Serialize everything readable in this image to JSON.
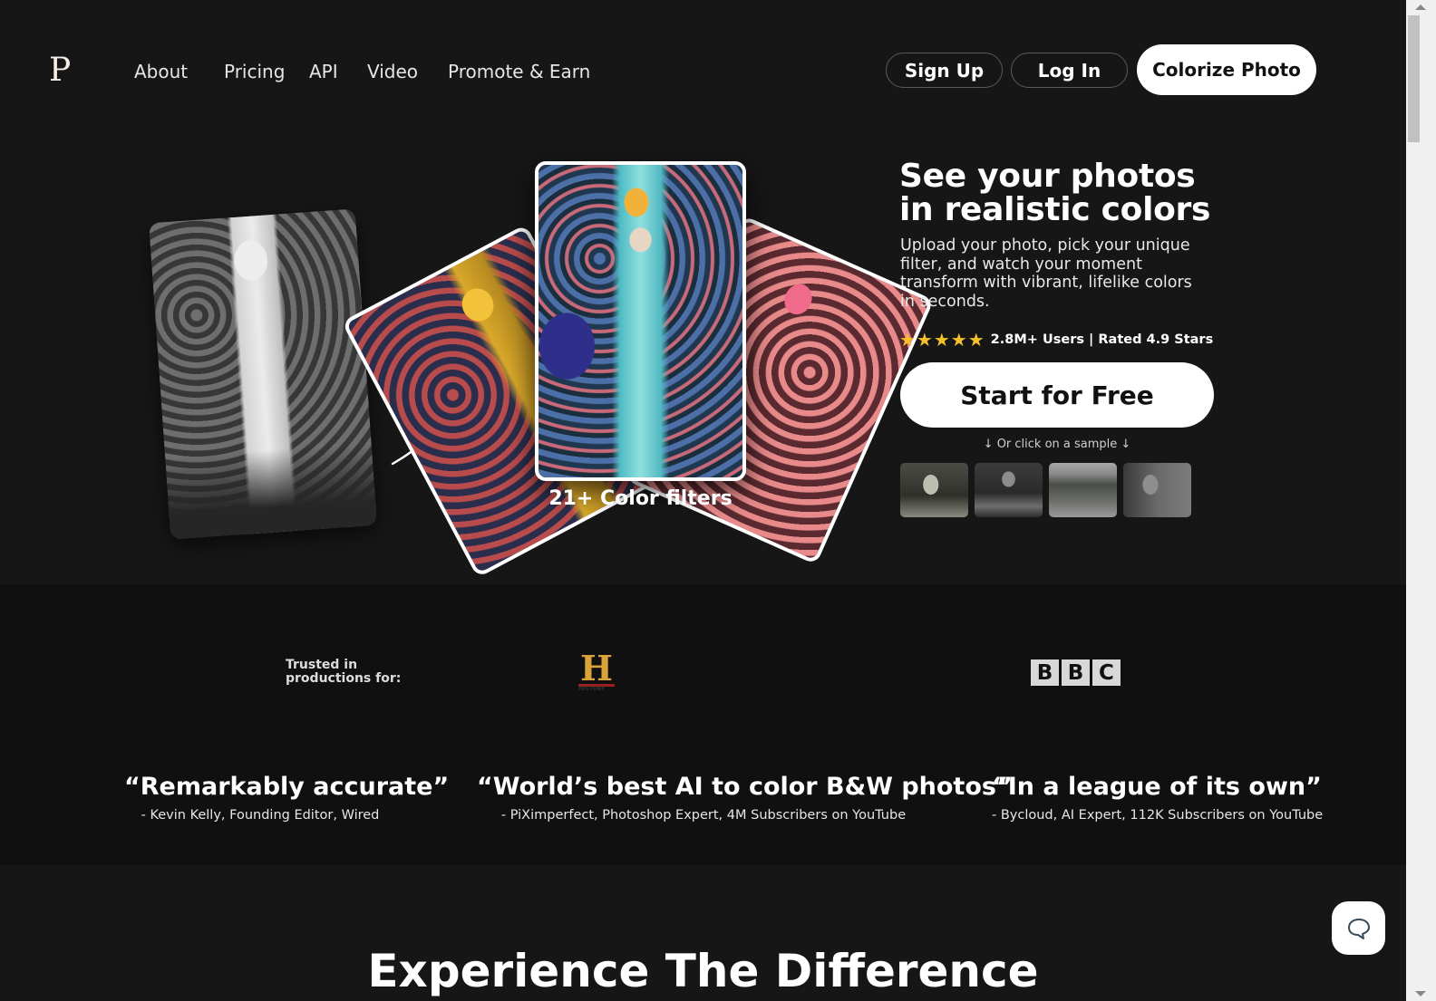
{
  "header": {
    "logo": "P",
    "nav": [
      "About",
      "Pricing",
      "API",
      "Video",
      "Promote & Earn"
    ],
    "sign_up": "Sign Up",
    "log_in": "Log In",
    "colorize": "Colorize Photo"
  },
  "hero": {
    "filters_label": "21+ Color filters",
    "title": "See your photos in realistic colors",
    "subtitle": "Upload your photo, pick your unique filter, and watch your moment transform with vibrant, lifelike colors in seconds.",
    "stars": "★★★★★",
    "rating_value": 4.9,
    "rating_text": "2.8M+ Users | Rated 4.9 Stars",
    "cta": "Start for Free",
    "sample_hint": "↓ Or click on a sample ↓",
    "samples": [
      "sample-woman-garden",
      "sample-man-desk",
      "sample-garden-path",
      "sample-mother-children"
    ]
  },
  "trusted": {
    "label": "Trusted in productions for:",
    "logos": [
      "HISTORY",
      "BBC"
    ],
    "history_letter": "H",
    "history_text": "HISTORY",
    "bbc_letters": [
      "B",
      "B",
      "C"
    ]
  },
  "quotes": [
    {
      "text": "“Remarkably accurate”",
      "by": "- Kevin Kelly, Founding Editor, Wired"
    },
    {
      "text": "“World’s best AI to color B&W photos”",
      "by": "- PiXimperfect, Photoshop Expert, 4M Subscribers on YouTube"
    },
    {
      "text": "“In a league of its own”",
      "by": "- Bycloud, AI Expert, 112K Subscribers on YouTube"
    }
  ],
  "section2": {
    "title": "Experience The Difference"
  },
  "colors": {
    "background": "#171617",
    "trusted_bg": "#111011",
    "star": "#f5c02b"
  }
}
